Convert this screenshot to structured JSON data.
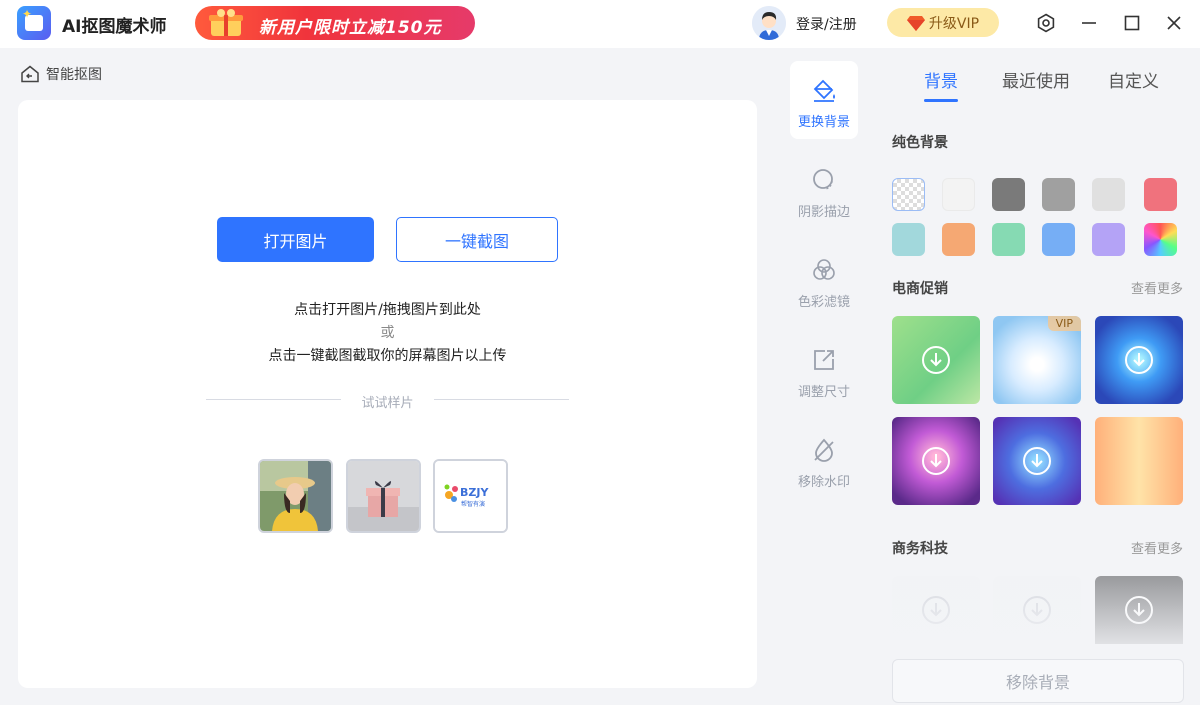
{
  "app": {
    "title": "AI抠图魔术师",
    "promo_text": "新用户限时立减150元",
    "login_label": "登录/注册",
    "vip_label": "升级VIP"
  },
  "breadcrumb": {
    "label": "智能抠图"
  },
  "main": {
    "open_button": "打开图片",
    "capture_button": "一键截图",
    "hint_line1": "点击打开图片/拖拽图片到此处",
    "hint_or": "或",
    "hint_line2": "点击一键截图截取你的屏幕图片以上传",
    "samples_label": "试试样片",
    "samples": [
      {
        "name": "woman-portrait"
      },
      {
        "name": "gift-box"
      },
      {
        "name": "logo",
        "text": "BZJY",
        "subtext": "帮智有演"
      }
    ]
  },
  "tools": [
    {
      "label": "更换背景",
      "icon": "paint-bucket-icon",
      "active": true
    },
    {
      "label": "阴影描边",
      "icon": "shadow-icon",
      "active": false
    },
    {
      "label": "色彩滤镜",
      "icon": "color-filter-icon",
      "active": false
    },
    {
      "label": "调整尺寸",
      "icon": "resize-icon",
      "active": false
    },
    {
      "label": "移除水印",
      "icon": "remove-watermark-icon",
      "active": false
    }
  ],
  "panel": {
    "tabs": [
      "背景",
      "最近使用",
      "自定义"
    ],
    "active_tab": "背景",
    "solid_title": "纯色背景",
    "promo_title": "电商促销",
    "tech_title": "商务科技",
    "see_more": "查看更多",
    "vip_tag": "VIP",
    "remove_bg_label": "移除背景",
    "solid_colors": [
      "transparent",
      "#f3f3f3",
      "#7a7a7a",
      "#a0a0a0",
      "#e0e0e0",
      "#f0727d",
      "#a2d8dc",
      "#f5a873",
      "#86dab3",
      "#76aef5",
      "#b4a3f6",
      "rainbow"
    ]
  },
  "colors": {
    "accent": "#2f74ff",
    "vip_bg": "#fde9a6",
    "promo_red": "#f0343c"
  }
}
